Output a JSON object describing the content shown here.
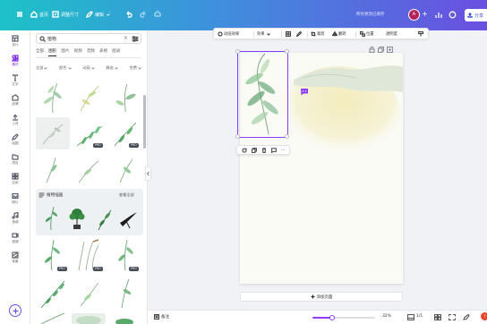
{
  "topbar": {
    "home": "首页",
    "resize": "调整尺寸",
    "edit": "编辑",
    "status": "所有更改已保存",
    "avatar": "A",
    "plus": "+",
    "share": "分享"
  },
  "rail": {
    "items": [
      {
        "label": "设计",
        "icon": "layout-icon"
      },
      {
        "label": "素材",
        "icon": "elements-icon",
        "active": true
      },
      {
        "label": "文字",
        "icon": "text-icon"
      },
      {
        "label": "品牌",
        "icon": "brand-icon"
      },
      {
        "label": "上传",
        "icon": "upload-icon"
      },
      {
        "label": "绘图",
        "icon": "draw-icon"
      },
      {
        "label": "项目",
        "icon": "projects-icon"
      },
      {
        "label": "应用",
        "icon": "apps-icon"
      },
      {
        "label": "照片",
        "icon": "photos-icon"
      },
      {
        "label": "音频",
        "icon": "audio-icon"
      },
      {
        "label": "视频",
        "icon": "video-icon"
      },
      {
        "label": "背景",
        "icon": "background-icon"
      }
    ]
  },
  "panel": {
    "search_value": "植物",
    "tabs": [
      "全部",
      "图形",
      "图片",
      "视频",
      "音频",
      "表格",
      "图表"
    ],
    "active_tab": 1,
    "filters": [
      "全部",
      "颜色",
      "动画",
      "静态",
      "免费"
    ],
    "section_title": "植物插画",
    "section_more": "查看全部",
    "badge": "PRO"
  },
  "toolbar": {
    "animate": "动画效果",
    "effects": "效果",
    "crop": "裁剪",
    "flip": "翻转",
    "position": "位置",
    "transparency": "透明度"
  },
  "canvas": {
    "add_page": "添加页面"
  },
  "footer": {
    "notes": "备注",
    "zoom_percent": 32,
    "zoom": "32%",
    "page": "1/1"
  },
  "help": "?",
  "colors": {
    "accent": "#8b3dff",
    "topbar_start": "#1dc2c8",
    "topbar_end": "#6a4fe0",
    "leaf_green": "#6fae7a"
  }
}
